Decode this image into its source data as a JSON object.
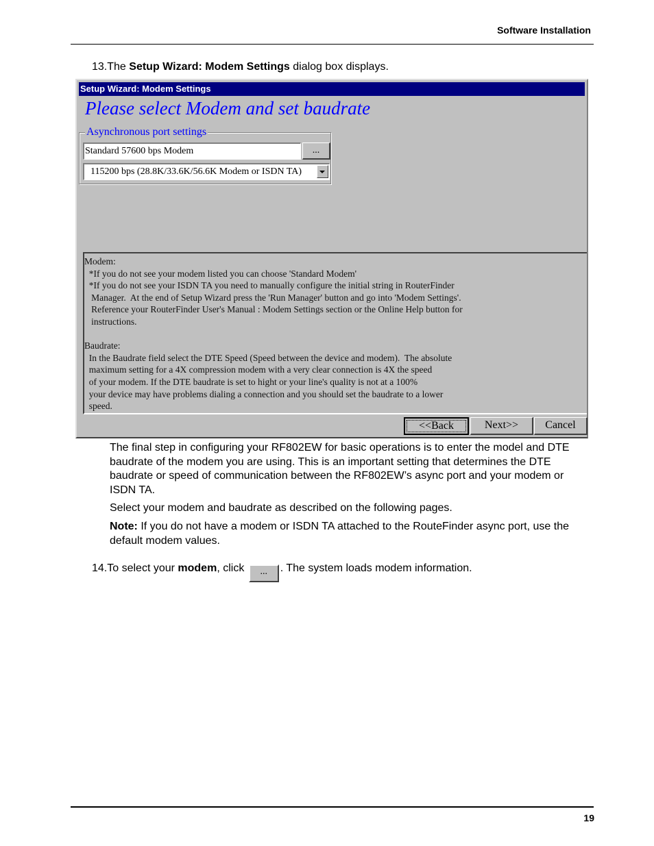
{
  "page": {
    "header_title": "Software Installation",
    "page_number": "19"
  },
  "step13": {
    "number": "13.",
    "prefix": "The ",
    "bold": "Setup Wizard: Modem Settings",
    "suffix": " dialog box displays."
  },
  "dialog": {
    "title": "Setup Wizard: Modem Settings",
    "heading": "Please select Modem and set baudrate",
    "group_label": "Asynchronous port settings",
    "modem_value": "Standard 57600 bps Modem",
    "browse_label": "...",
    "baudrate_value": "115200 bps (28.8K/33.6K/56.6K Modem or ISDN TA)",
    "help_lines": [
      "Modem:",
      "  *If you do not see your modem listed you can choose 'Standard Modem'",
      "  *If you do not see your ISDN TA you need to manually configure the initial string in RouterFinder",
      "   Manager.  At the end of Setup Wizard press the 'Run Manager' button and go into 'Modem Settings'.",
      "   Reference your RouterFinder User's Manual : Modem Settings section or the Online Help button for",
      "   instructions.",
      "",
      "Baudrate:",
      "  In the Baudrate field select the DTE Speed (Speed between the device and modem).  The absolute",
      "  maximum setting for a 4X compression modem with a very clear connection is 4X the speed",
      "  of your modem. If the DTE baudrate is set to hight or your line's quality is not at a 100%",
      "  your device may have problems dialing a connection and you should set the baudrate to a lower",
      "  speed."
    ],
    "buttons": {
      "back": "<<Back",
      "next": "Next>>",
      "cancel": "Cancel"
    }
  },
  "body": {
    "para1": "The final step in configuring your RF802EW for basic operations is to enter the model and DTE baudrate of the modem you are using.  This is an important setting that determines the DTE baudrate or speed of communication between the RF802EW’s async port and your modem or ISDN TA.",
    "para2": "Select your modem and baudrate as described on the following pages.",
    "note_label": "Note:",
    "note_text": " If you do not have a modem or ISDN TA attached to the RouteFinder async port, use the default modem values."
  },
  "step14": {
    "number": "14.",
    "prefix": "To select your ",
    "bold": "modem",
    "middle": ", click ",
    "button_label": "...",
    "suffix": ".  The system loads modem information."
  }
}
